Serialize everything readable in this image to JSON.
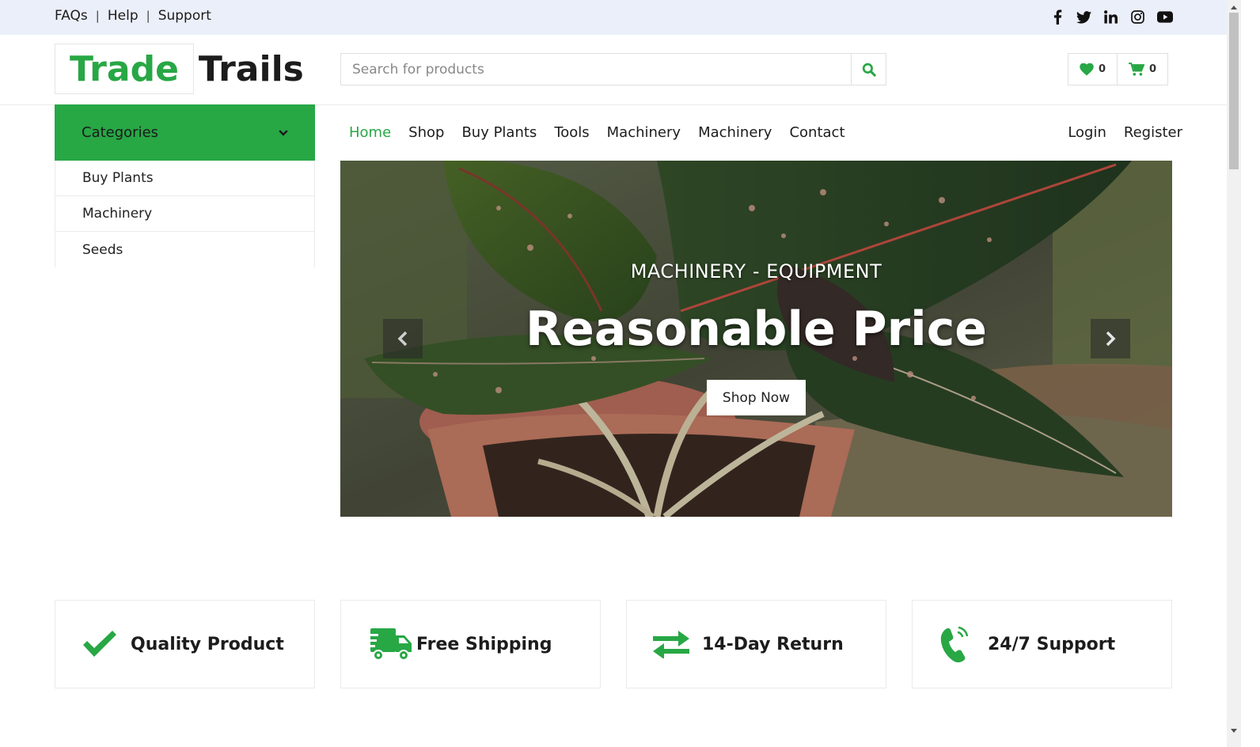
{
  "topbar": {
    "links": [
      "FAQs",
      "Help",
      "Support"
    ],
    "social_icons": [
      "facebook-icon",
      "twitter-icon",
      "linkedin-icon",
      "instagram-icon",
      "youtube-icon"
    ]
  },
  "logo": {
    "part1": "Trade",
    "part2": "Trails"
  },
  "search": {
    "placeholder": "Search for products",
    "value": ""
  },
  "header_buttons": {
    "wishlist_count": "0",
    "cart_count": "0"
  },
  "categories": {
    "title": "Categories",
    "items": [
      "Buy Plants",
      "Machinery",
      "Seeds"
    ]
  },
  "nav": {
    "items": [
      "Home",
      "Shop",
      "Buy Plants",
      "Tools",
      "Machinery",
      "Machinery",
      "Contact"
    ],
    "active": "Home",
    "right": [
      "Login",
      "Register"
    ]
  },
  "hero": {
    "subtitle": "MACHINERY - EQUIPMENT",
    "title": "Reasonable Price",
    "button": "Shop Now"
  },
  "features": [
    {
      "icon": "check-icon",
      "label": "Quality Product"
    },
    {
      "icon": "truck-icon",
      "label": "Free Shipping"
    },
    {
      "icon": "exchange-icon",
      "label": "14-Day Return"
    },
    {
      "icon": "phone-icon",
      "label": "24/7 Support"
    }
  ],
  "colors": {
    "accent": "#28a745",
    "topbar_bg": "#ebeff9",
    "text": "#1c1c1c"
  }
}
